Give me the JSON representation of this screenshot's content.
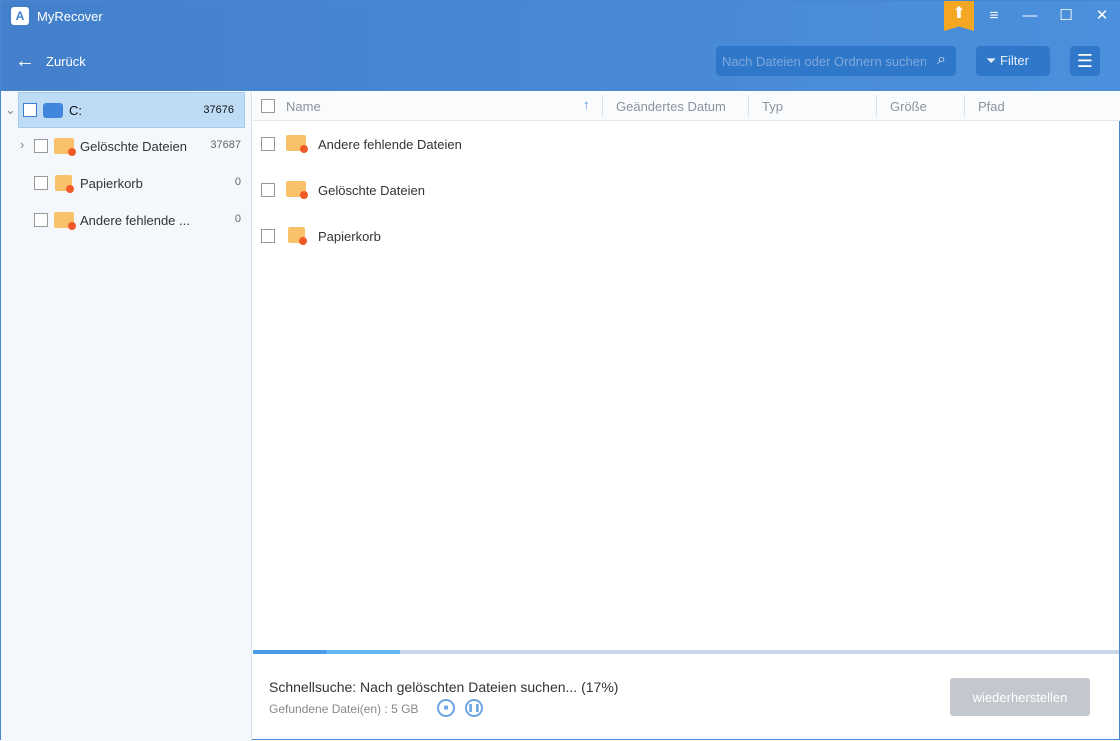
{
  "app": {
    "title": "MyRecover"
  },
  "header": {
    "back_label": "Zurück",
    "search_placeholder": "Nach Dateien oder Ordnern suchen",
    "filter_label": "Filter"
  },
  "tree": [
    {
      "label": "C:",
      "count": "37676"
    },
    {
      "label": "Gelöschte Dateien",
      "count": "37687"
    },
    {
      "label": "Papierkorb",
      "count": "0"
    },
    {
      "label": "Andere fehlende ...",
      "count": "0"
    }
  ],
  "columns": [
    "Name",
    "Geändertes Datum",
    "Typ",
    "Größe",
    "Pfad"
  ],
  "files": [
    "Andere fehlende Dateien",
    "Gelöschte Dateien",
    "Papierkorb"
  ],
  "footer": {
    "status": "Schnellsuche: Nach gelöschten Dateien suchen... (17%)",
    "found": "Gefundene Datei(en) : 5 GB",
    "restore_label": "wiederherstellen",
    "progress_percent": 17
  },
  "colors": {
    "header": "#4480cc",
    "accent": "#f5a623"
  }
}
